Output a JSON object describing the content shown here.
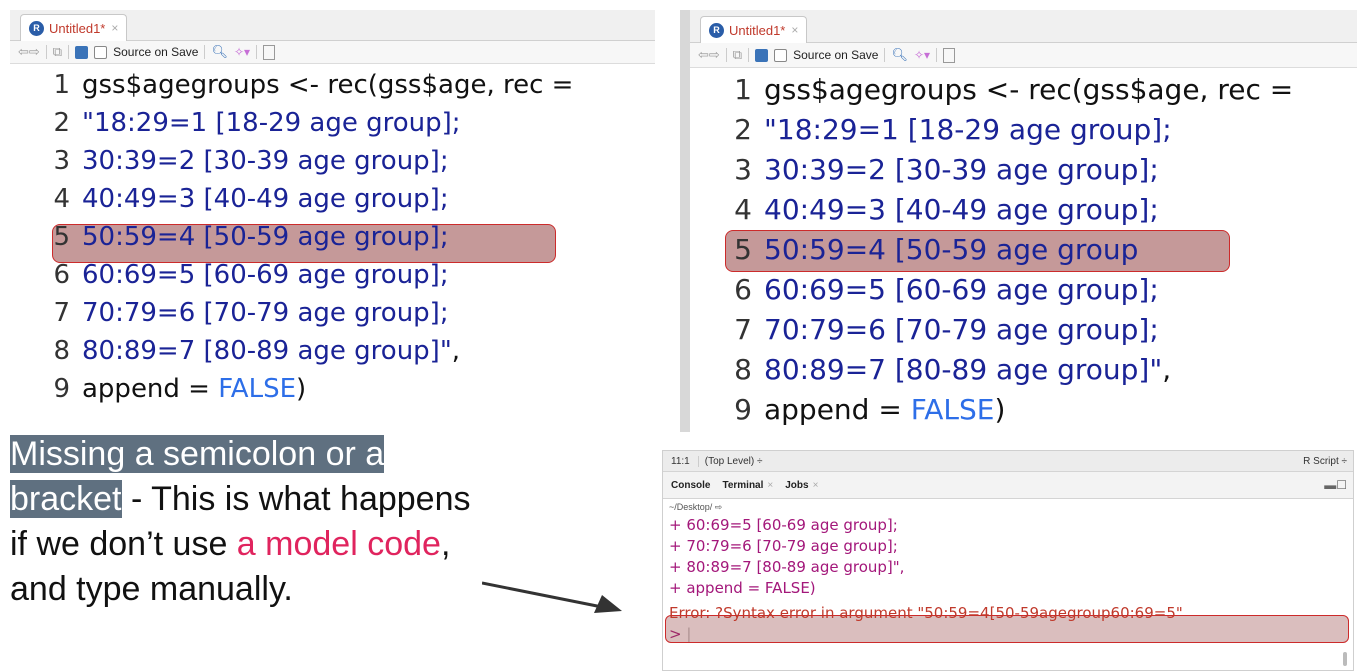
{
  "left_editor": {
    "tab_label": "Untitled1*",
    "tab_close": "×",
    "toolbar": {
      "source_on_save": "Source on Save"
    },
    "lines": [
      {
        "num": "1",
        "tokens": [
          {
            "t": "gss$agegroups <- rec(gss$age, rec =",
            "c": "b"
          }
        ]
      },
      {
        "num": "2",
        "tokens": [
          {
            "t": "\"18:29=1 [18-29 age group];",
            "c": "s"
          }
        ]
      },
      {
        "num": "3",
        "tokens": [
          {
            "t": "30:39=2 [30-39 age group];",
            "c": "s"
          }
        ]
      },
      {
        "num": "4",
        "tokens": [
          {
            "t": "40:49=3 [40-49 age group];",
            "c": "s"
          }
        ]
      },
      {
        "num": "5",
        "tokens": [
          {
            "t": "50:59=4 [50-59 age group];",
            "c": "s"
          }
        ]
      },
      {
        "num": "6",
        "tokens": [
          {
            "t": "60:69=5 [60-69 age group];",
            "c": "s"
          }
        ]
      },
      {
        "num": "7",
        "tokens": [
          {
            "t": "70:79=6 [70-79 age group];",
            "c": "s"
          }
        ]
      },
      {
        "num": "8",
        "tokens": [
          {
            "t": "80:89=7 [80-89 age group]\"",
            "c": "s"
          },
          {
            "t": ",",
            "c": "b"
          }
        ]
      },
      {
        "num": "9",
        "tokens": [
          {
            "t": "append = ",
            "c": "b"
          },
          {
            "t": "FALSE",
            "c": "k"
          },
          {
            "t": ")",
            "c": "b"
          }
        ]
      }
    ]
  },
  "right_editor": {
    "tab_label": "Untitled1*",
    "tab_close": "×",
    "toolbar": {
      "source_on_save": "Source on Save"
    },
    "lines": [
      {
        "num": "1",
        "tokens": [
          {
            "t": "gss$agegroups <- rec(gss$age, rec =",
            "c": "b"
          }
        ]
      },
      {
        "num": "2",
        "tokens": [
          {
            "t": "\"18:29=1 [18-29 age group];",
            "c": "s"
          }
        ]
      },
      {
        "num": "3",
        "tokens": [
          {
            "t": "30:39=2 [30-39 age group];",
            "c": "s"
          }
        ]
      },
      {
        "num": "4",
        "tokens": [
          {
            "t": "40:49=3 [40-49 age group];",
            "c": "s"
          }
        ]
      },
      {
        "num": "5",
        "tokens": [
          {
            "t": "50:59=4 [50-59 age group",
            "c": "s"
          }
        ]
      },
      {
        "num": "6",
        "tokens": [
          {
            "t": "60:69=5 [60-69 age group];",
            "c": "s"
          }
        ]
      },
      {
        "num": "7",
        "tokens": [
          {
            "t": "70:79=6 [70-79 age group];",
            "c": "s"
          }
        ]
      },
      {
        "num": "8",
        "tokens": [
          {
            "t": "80:89=7 [80-89 age group]\"",
            "c": "s"
          },
          {
            "t": ",",
            "c": "b"
          }
        ]
      },
      {
        "num": "9",
        "tokens": [
          {
            "t": "append = ",
            "c": "b"
          },
          {
            "t": "FALSE",
            "c": "k"
          },
          {
            "t": ")",
            "c": "b"
          }
        ]
      }
    ]
  },
  "note": {
    "highlight": "Missing a semicolon or a bracket",
    "text1": " - This is what happens if we don’t use ",
    "pink": "a model code",
    "text2": ", and type manually."
  },
  "console": {
    "status_pos": "11:1",
    "status_level": "(Top Level) ÷",
    "status_type": "R Script ÷",
    "tabs": [
      {
        "label": "Console",
        "close": ""
      },
      {
        "label": "Terminal",
        "close": "×"
      },
      {
        "label": "Jobs",
        "close": "×"
      }
    ],
    "path": "~/Desktop/ ⇨",
    "lines": [
      "+ 60:69=5 [60-69 age group];",
      "+ 70:79=6 [70-79 age group];",
      "+ 80:89=7 [80-89 age group]\",",
      "+ append = FALSE)"
    ],
    "error": "Error: ?Syntax error in argument \"50:59=4[50-59agegroup60:69=5\"",
    "prompt": ">"
  }
}
